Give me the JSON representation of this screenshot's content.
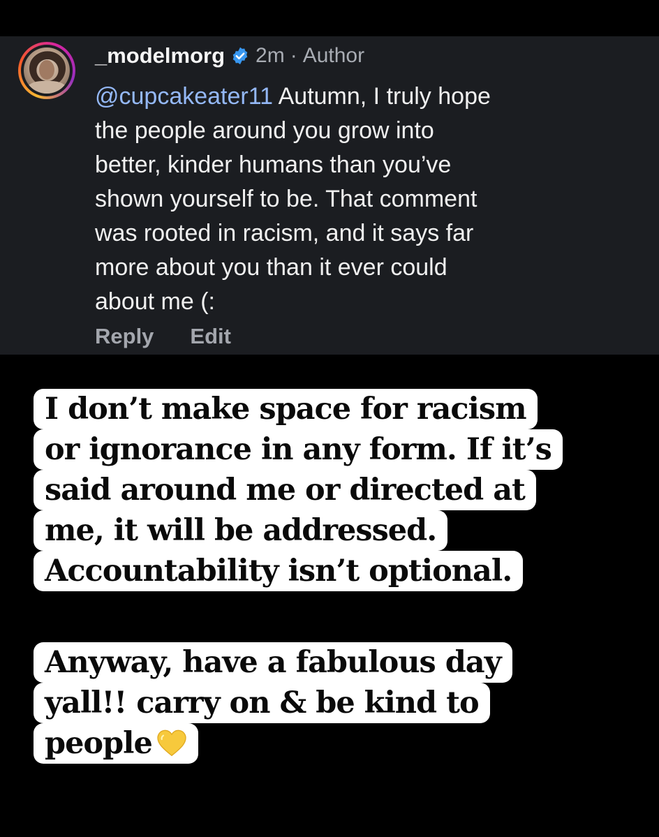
{
  "comment": {
    "username": "_modelmorg",
    "time": "2m",
    "separator": "·",
    "role": "Author",
    "mention": "@cupcakeater11",
    "lines": [
      " Autumn, I truly hope",
      "the people around you grow into",
      "better, kinder humans than you’ve",
      "shown yourself to be. That comment",
      "was rooted in racism, and it says far",
      "more about you than it ever could",
      "about me (:"
    ],
    "actions": {
      "reply": "Reply",
      "edit": "Edit"
    }
  },
  "captions": [
    {
      "lines": [
        "I don’t make space for racism",
        "or ignorance in any form. If it’s",
        "said around me or directed at",
        "me, it will be addressed.",
        "Accountability isn’t optional."
      ]
    },
    {
      "lines": [
        "Anyway, have a fabulous day",
        "yall!! carry on & be kind to",
        "people"
      ]
    }
  ],
  "icons": {
    "verified": "verified-badge-icon",
    "heart": "yellow-heart-icon"
  },
  "colors": {
    "background": "#000000",
    "comment_card": "#1b1d21",
    "mention": "#94b8f6",
    "meta": "#a8acb3",
    "verified_badge": "#3897f0",
    "heart": "#f7c93c",
    "caption_bg": "#ffffff"
  }
}
